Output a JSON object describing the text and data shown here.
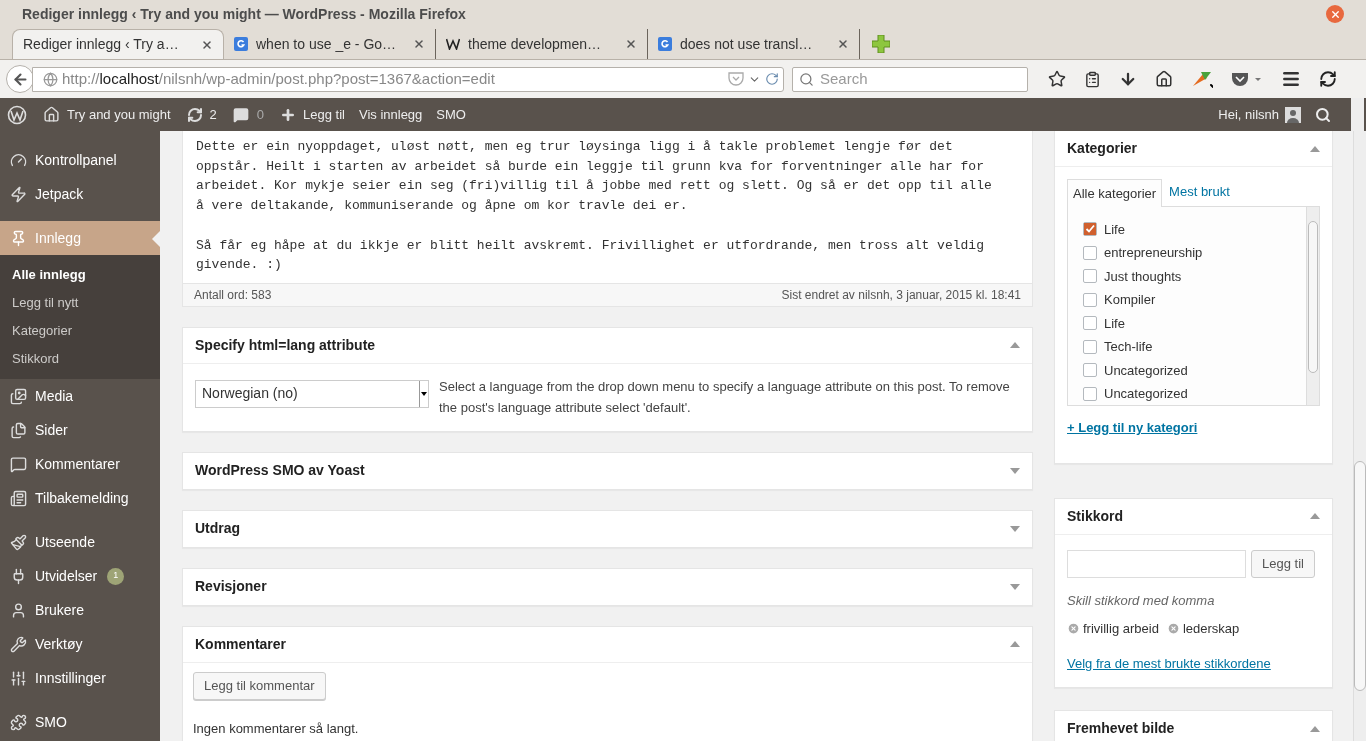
{
  "window": {
    "title": "Rediger innlegg ‹ Try and you might — WordPress - Mozilla Firefox"
  },
  "browser_tabs": [
    {
      "label": "Rediger innlegg ‹ Try a…",
      "kind": "plain",
      "selected": true
    },
    {
      "label": "when to use _e - Go…",
      "kind": "search",
      "selected": false
    },
    {
      "label": "theme developmen…",
      "kind": "wiki",
      "selected": false
    },
    {
      "label": "does not use transl…",
      "kind": "search",
      "selected": false
    }
  ],
  "address_bar": {
    "scheme": "http://",
    "host": "localhost",
    "path": "/nilsnh/wp-admin/post.php?post=1367&action=edit"
  },
  "search": {
    "placeholder": "Search"
  },
  "admin_bar": {
    "site": "Try and you might",
    "updates": "2",
    "comments": "0",
    "new": "Legg til",
    "view": "Vis innlegg",
    "smo": "SMO",
    "greeting": "Hei, nilsnh"
  },
  "sidebar": {
    "groups": [
      [
        {
          "kind": "gauge",
          "label": "Kontrollpanel",
          "selected": false
        },
        {
          "kind": "jetpack",
          "label": "Jetpack",
          "selected": false
        }
      ],
      [
        {
          "kind": "pin",
          "label": "Innlegg",
          "selected": true,
          "children": [
            {
              "label": "Alle innlegg",
              "selected": true
            },
            {
              "label": "Legg til nytt",
              "selected": false
            },
            {
              "label": "Kategorier",
              "selected": false
            },
            {
              "label": "Stikkord",
              "selected": false
            }
          ]
        },
        {
          "kind": "media",
          "label": "Media",
          "selected": false
        },
        {
          "kind": "pages",
          "label": "Sider",
          "selected": false
        },
        {
          "kind": "comment",
          "label": "Kommentarer",
          "selected": false
        },
        {
          "kind": "feedback",
          "label": "Tilbakemelding",
          "selected": false
        }
      ],
      [
        {
          "kind": "brush",
          "label": "Utseende",
          "selected": false
        },
        {
          "kind": "plug",
          "label": "Utvidelser",
          "selected": false,
          "badge": "1"
        },
        {
          "kind": "user",
          "label": "Brukere",
          "selected": false
        },
        {
          "kind": "wrench",
          "label": "Verktøy",
          "selected": false
        },
        {
          "kind": "sliders",
          "label": "Innstillinger",
          "selected": false
        }
      ],
      [
        {
          "kind": "smo",
          "label": "SMO",
          "selected": false
        }
      ]
    ]
  },
  "editor": {
    "paragraphs": [
      "Dette er ein nyoppdaget, uløst nøtt, men eg trur løysinga ligg i å takle problemet lengje før det oppstår. Heilt i starten av arbeidet så burde ein leggje til grunn kva for forventninger alle har for arbeidet. Kor mykje seier ein seg (fri)villig til å jobbe med rett og slett. Og så er det opp til alle å vere deltakande, kommuniserande og åpne om kor travle dei er.",
      "Så får eg håpe at du ikkje er blitt heilt avskremt. Frivillighet er utfordrande, men tross alt veldig givende. :)"
    ],
    "word_count": "Antall ord: 583",
    "last_edited": "Sist endret av nilsnh, 3 januar, 2015 kl. 18:41"
  },
  "meta_boxes": [
    {
      "kind": "language",
      "title": "Specify html=lang attribute",
      "expanded": true,
      "select_value": "Norwegian (no)",
      "help": "Select a language from the drop down menu to specify a language attribute on this post. To remove the post's language attribute select 'default'."
    },
    {
      "kind": "plain",
      "title": "WordPress SMO av Yoast",
      "expanded": false
    },
    {
      "kind": "plain",
      "title": "Utdrag",
      "expanded": false
    },
    {
      "kind": "plain",
      "title": "Revisjoner",
      "expanded": false
    },
    {
      "kind": "comments",
      "title": "Kommentarer",
      "expanded": true,
      "button": "Legg til kommentar",
      "note": "Ingen kommentarer så langt."
    }
  ],
  "categories": {
    "title": "Kategorier",
    "expanded": true,
    "tabs": [
      {
        "label": "Alle kategorier",
        "selected": true
      },
      {
        "label": "Mest brukt",
        "selected": false
      }
    ],
    "items": [
      {
        "label": "Life",
        "checked": true
      },
      {
        "label": "entrepreneurship",
        "checked": false
      },
      {
        "label": "Just thoughts",
        "checked": false
      },
      {
        "label": "Kompiler",
        "checked": false
      },
      {
        "label": "Life",
        "checked": false
      },
      {
        "label": "Tech-life",
        "checked": false
      },
      {
        "label": "Uncategorized",
        "checked": false
      },
      {
        "label": "Uncategorized",
        "checked": false
      }
    ],
    "add_link": "+ Legg til ny kategori"
  },
  "tags_box": {
    "title": "Stikkord",
    "expanded": true,
    "button": "Legg til",
    "hint": "Skill stikkord med komma",
    "tags": [
      "frivillig arbeid",
      "lederskap"
    ],
    "link": "Velg fra de mest brukte stikkordene"
  },
  "featured_image": {
    "title": "Fremhevet bilde",
    "expanded": true
  }
}
